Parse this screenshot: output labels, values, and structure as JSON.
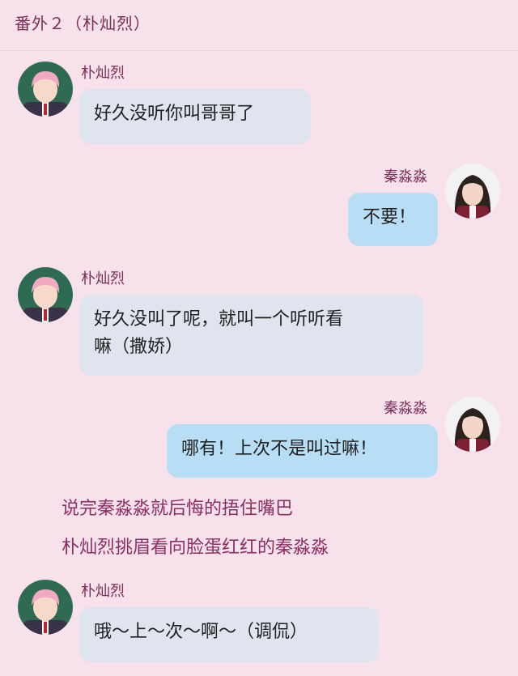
{
  "header": {
    "title": "番外２（朴灿烈）"
  },
  "messages": [
    {
      "sender": "朴灿烈",
      "side": "left",
      "lines": [
        "好久没听你叫哥哥了"
      ]
    },
    {
      "sender": "秦淼淼",
      "side": "right",
      "lines": [
        "不要！"
      ]
    },
    {
      "sender": "朴灿烈",
      "side": "left",
      "lines": [
        "好久没叫了呢，就叫一个听听看",
        "嘛（撒娇）"
      ]
    },
    {
      "sender": "秦淼淼",
      "side": "right",
      "lines": [
        "哪有！上次不是叫过嘛！"
      ]
    },
    {
      "sender": "朴灿烈",
      "side": "left",
      "lines": [
        "哦～上～次～啊～（调侃）"
      ]
    }
  ],
  "narration": [
    "说完秦淼淼就后悔的捂住嘴巴",
    "朴灿烈挑眉看向脸蛋红红的秦淼淼"
  ],
  "avatars": {
    "male": {
      "icon": "pink-haired-boy-avatar",
      "colors": {
        "bg": "#2f6b52",
        "hair": "#f3a9c4",
        "skin": "#f6d9c8",
        "jacket": "#3a3247"
      }
    },
    "female": {
      "icon": "dark-haired-girl-avatar",
      "colors": {
        "bg": "#f2f2f2",
        "hair": "#2b211d",
        "skin": "#f4d6c6",
        "jacket": "#7e1f34"
      }
    }
  },
  "colors": {
    "background": "#f7e1ea",
    "left_bubble": "#dfe4ee",
    "right_bubble": "#b8def5",
    "name_text": "#7a2f5a",
    "narration_text": "#8a2f63"
  }
}
